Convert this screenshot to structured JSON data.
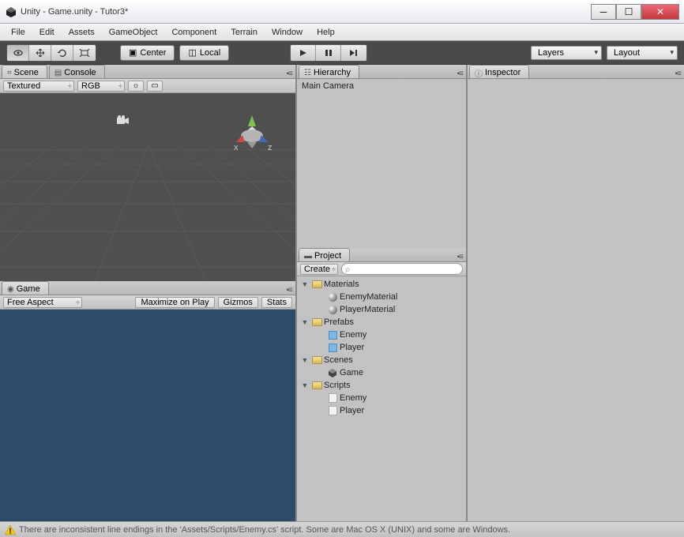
{
  "window": {
    "title": "Unity - Game.unity - Tutor3*"
  },
  "menu": [
    "File",
    "Edit",
    "Assets",
    "GameObject",
    "Component",
    "Terrain",
    "Window",
    "Help"
  ],
  "toolbar": {
    "pivot": {
      "center": "Center",
      "local": "Local"
    },
    "layers": "Layers",
    "layout": "Layout"
  },
  "scene_tab": "Scene",
  "console_tab": "Console",
  "game_tab": "Game",
  "hierarchy_tab": "Hierarchy",
  "project_tab": "Project",
  "inspector_tab": "Inspector",
  "scene_strip": {
    "draw": "Textured",
    "render": "RGB"
  },
  "game_strip": {
    "aspect": "Free Aspect",
    "maximize": "Maximize on Play",
    "gizmos": "Gizmos",
    "stats": "Stats"
  },
  "hierarchy": {
    "items": [
      "Main Camera"
    ]
  },
  "project_strip": {
    "create": "Create"
  },
  "project": {
    "folders": [
      {
        "name": "Materials",
        "children": [
          "EnemyMaterial",
          "PlayerMaterial"
        ],
        "type": "material"
      },
      {
        "name": "Prefabs",
        "children": [
          "Enemy",
          "Player"
        ],
        "type": "prefab"
      },
      {
        "name": "Scenes",
        "children": [
          "Game"
        ],
        "type": "scene"
      },
      {
        "name": "Scripts",
        "children": [
          "Enemy",
          "Player"
        ],
        "type": "script"
      }
    ]
  },
  "status": {
    "message": "There are inconsistent line endings in the 'Assets/Scripts/Enemy.cs' script. Some are Mac OS X (UNIX) and some are Windows."
  },
  "gizmo_axes": {
    "x": "x",
    "y": "y",
    "z": "z"
  }
}
